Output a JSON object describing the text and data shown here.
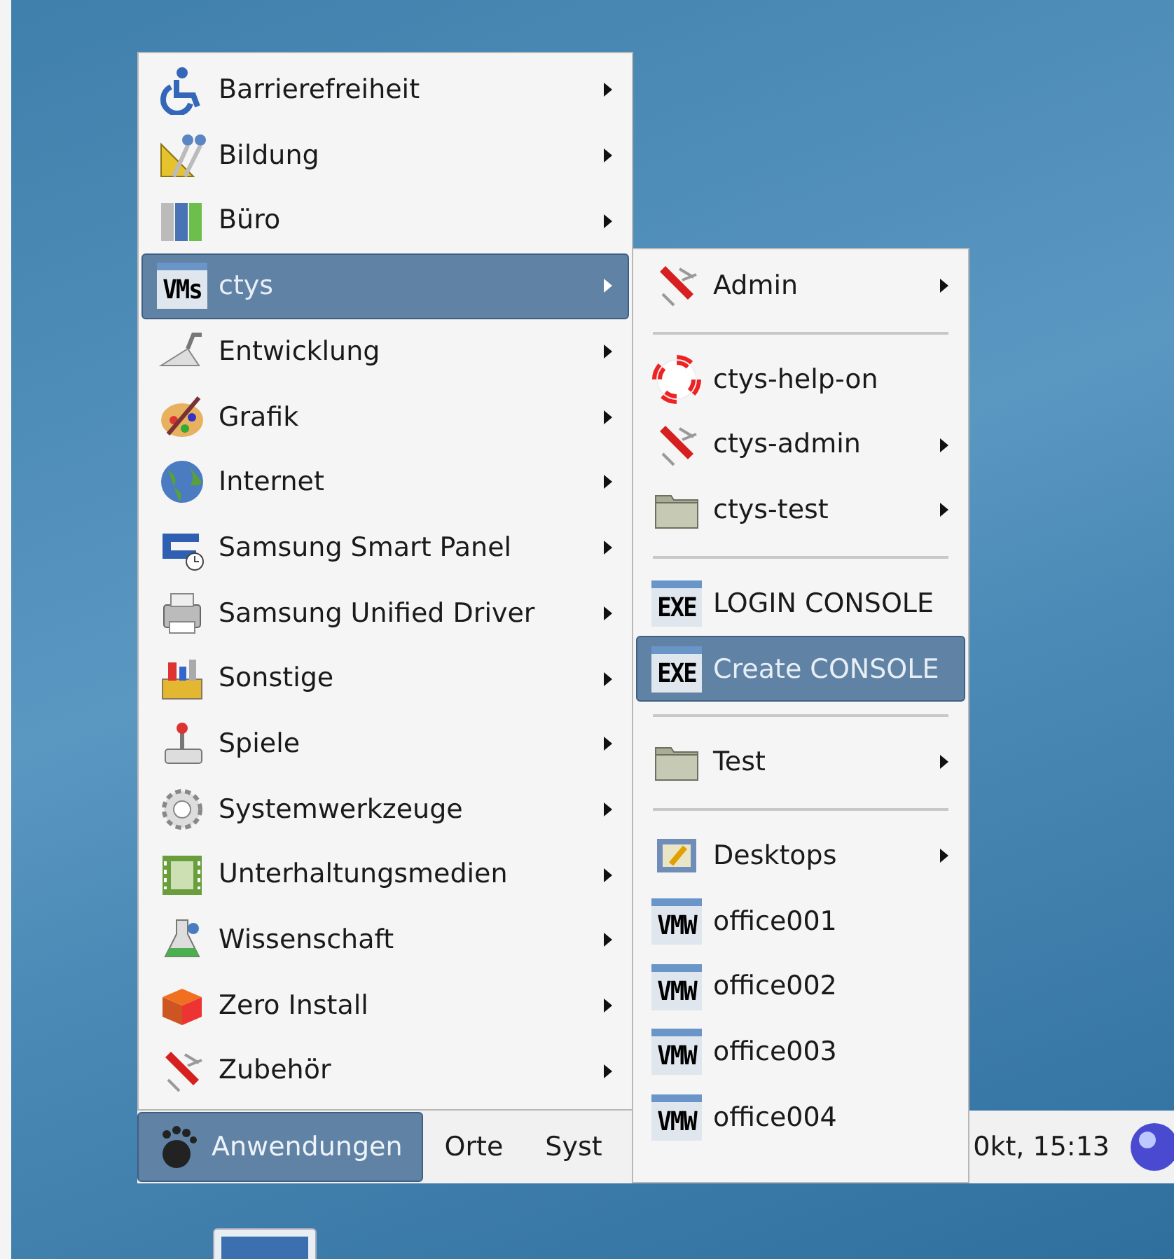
{
  "main_menu": {
    "items": [
      {
        "label": "Barrierefreiheit",
        "has_submenu": true,
        "selected": false
      },
      {
        "label": "Bildung",
        "has_submenu": true,
        "selected": false
      },
      {
        "label": "Büro",
        "has_submenu": true,
        "selected": false
      },
      {
        "label": "ctys",
        "has_submenu": true,
        "selected": true,
        "icon_text": "VMs"
      },
      {
        "label": "Entwicklung",
        "has_submenu": true,
        "selected": false
      },
      {
        "label": "Grafik",
        "has_submenu": true,
        "selected": false
      },
      {
        "label": "Internet",
        "has_submenu": true,
        "selected": false
      },
      {
        "label": "Samsung Smart Panel",
        "has_submenu": true,
        "selected": false
      },
      {
        "label": "Samsung Unified Driver",
        "has_submenu": true,
        "selected": false
      },
      {
        "label": "Sonstige",
        "has_submenu": true,
        "selected": false
      },
      {
        "label": "Spiele",
        "has_submenu": true,
        "selected": false
      },
      {
        "label": "Systemwerkzeuge",
        "has_submenu": true,
        "selected": false
      },
      {
        "label": "Unterhaltungsmedien",
        "has_submenu": true,
        "selected": false
      },
      {
        "label": "Wissenschaft",
        "has_submenu": true,
        "selected": false
      },
      {
        "label": "Zero Install",
        "has_submenu": true,
        "selected": false
      },
      {
        "label": "Zubehör",
        "has_submenu": true,
        "selected": false
      }
    ]
  },
  "submenu": {
    "items": [
      {
        "kind": "item",
        "label": "Admin",
        "has_submenu": true,
        "selected": false
      },
      {
        "kind": "separator"
      },
      {
        "kind": "item",
        "label": "ctys-help-on",
        "has_submenu": false,
        "selected": false
      },
      {
        "kind": "item",
        "label": "ctys-admin",
        "has_submenu": true,
        "selected": false
      },
      {
        "kind": "item",
        "label": "ctys-test",
        "has_submenu": true,
        "selected": false
      },
      {
        "kind": "separator"
      },
      {
        "kind": "item",
        "label": "LOGIN CONSOLE",
        "has_submenu": false,
        "selected": false,
        "icon_text": "EXE"
      },
      {
        "kind": "item",
        "label": "Create CONSOLE",
        "has_submenu": false,
        "selected": true,
        "icon_text": "EXE"
      },
      {
        "kind": "separator"
      },
      {
        "kind": "item",
        "label": "Test",
        "has_submenu": true,
        "selected": false
      },
      {
        "kind": "separator"
      },
      {
        "kind": "item",
        "label": "Desktops",
        "has_submenu": true,
        "selected": false
      },
      {
        "kind": "item",
        "label": "office001",
        "has_submenu": false,
        "selected": false,
        "icon_text": "VMW"
      },
      {
        "kind": "item",
        "label": "office002",
        "has_submenu": false,
        "selected": false,
        "icon_text": "VMW"
      },
      {
        "kind": "item",
        "label": "office003",
        "has_submenu": false,
        "selected": false,
        "icon_text": "VMW"
      },
      {
        "kind": "item",
        "label": "office004",
        "has_submenu": false,
        "selected": false,
        "icon_text": "VMW"
      }
    ]
  },
  "panel": {
    "menus": [
      {
        "label": "Anwendungen",
        "selected": true
      },
      {
        "label": "Orte",
        "selected": false
      },
      {
        "label": "Syst",
        "selected": false
      }
    ],
    "clock": "0kt, 15:13"
  }
}
